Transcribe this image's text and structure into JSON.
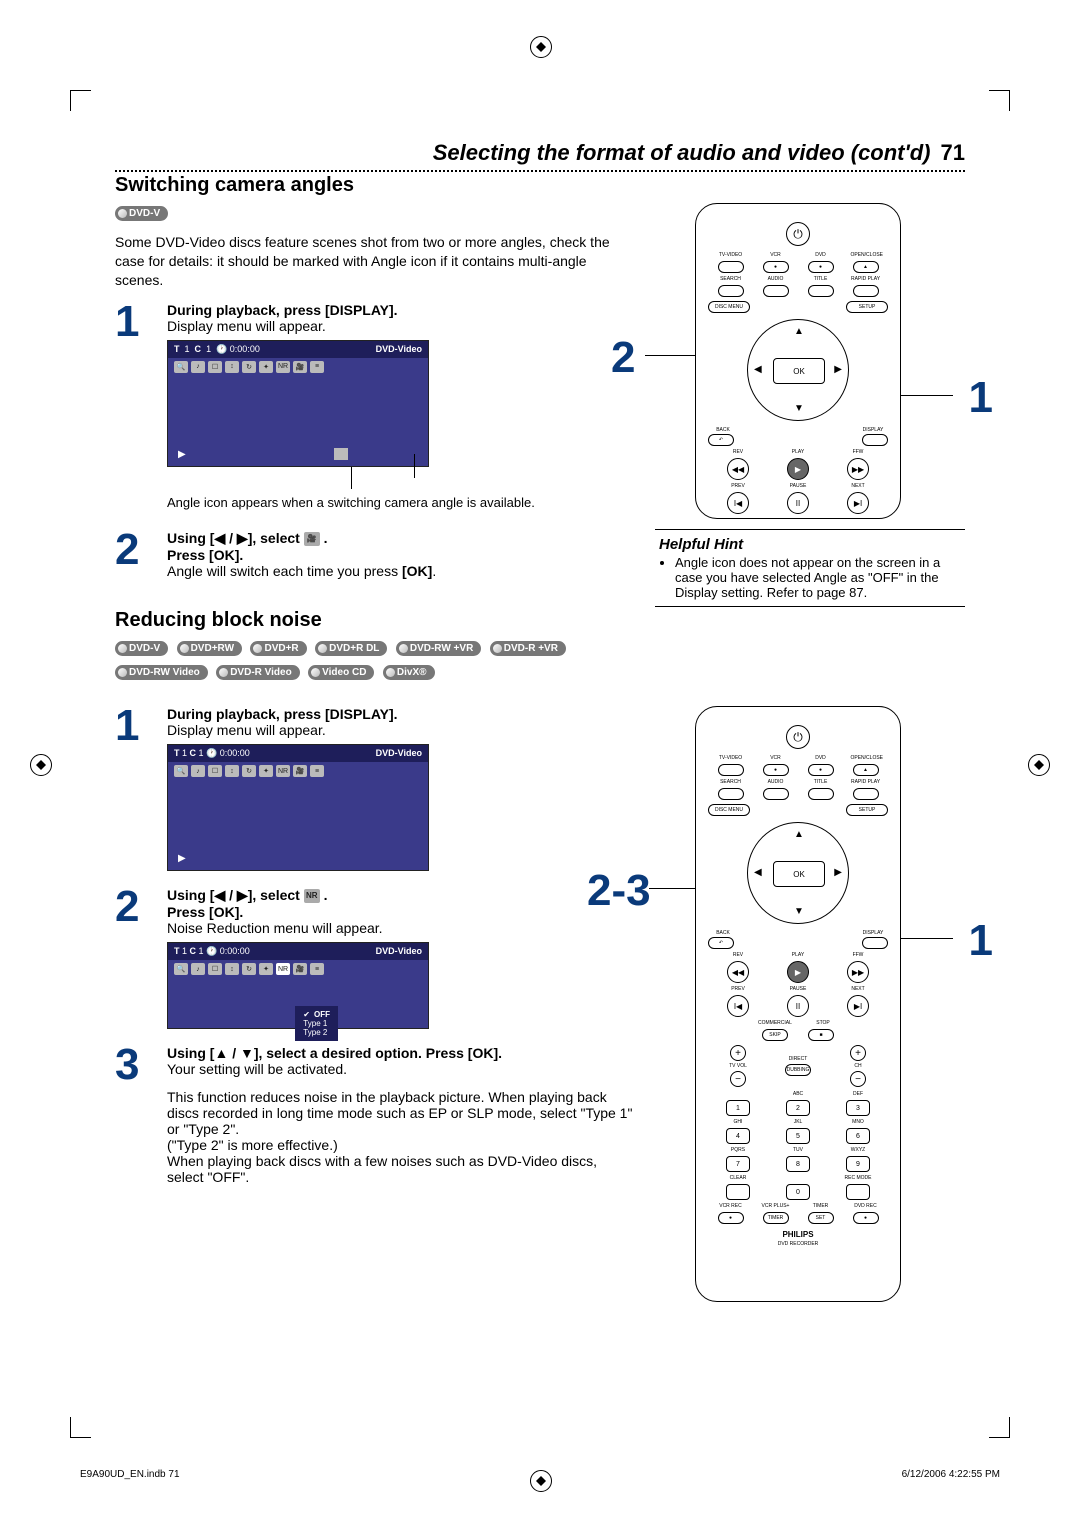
{
  "header": {
    "title": "Selecting the format of audio and video (cont'd)",
    "page": "71"
  },
  "section1": {
    "title": "Switching camera angles",
    "badge": "DVD-V",
    "intro": "Some DVD-Video discs feature scenes shot from two or more angles, check the case for details: it should be marked with Angle icon if it contains multi-angle scenes.",
    "step1_num": "1",
    "step1_bold": "During playback, press [DISPLAY].",
    "step1_text": "Display menu will appear.",
    "display": {
      "t": "T",
      "t_val": "1",
      "c": "C",
      "c_val": "1",
      "time": "0:00:00",
      "type": "DVD-Video"
    },
    "caption1": "Angle icon appears when a switching camera angle is available.",
    "step2_num": "2",
    "step2_line1a": "Using [",
    "step2_line1b": " / ",
    "step2_line1c": "], select ",
    "step2_line1d": " .",
    "step2_line2": "Press [OK].",
    "step2_text": "Angle will switch each time you press [OK]."
  },
  "remote1": {
    "callout_left": "2",
    "callout_right": "1",
    "power": "⏻",
    "row1_labels": [
      "TV-VIDEO",
      "VCR",
      "DVD",
      "OPEN/CLOSE"
    ],
    "row1_btns": [
      "",
      "●",
      "●",
      "▲"
    ],
    "row2_labels": [
      "SEARCH",
      "AUDIO",
      "TITLE",
      "RAPID PLAY"
    ],
    "wide_left": "DISC MENU",
    "wide_right": "SETUP",
    "ok": "OK",
    "row3_labels_l": "BACK",
    "row3_labels_r": "DISPLAY",
    "row4_labels": [
      "REV",
      "PLAY",
      "FFW"
    ],
    "row4_btns": [
      "◀◀",
      "▶",
      "▶▶"
    ],
    "row5_labels": [
      "PREV",
      "PAUSE",
      "NEXT"
    ],
    "row5_btns": [
      "I◀",
      "II",
      "▶I"
    ]
  },
  "hint": {
    "title": "Helpful Hint",
    "item": "Angle icon does not appear on the screen in a case you have selected Angle as \"OFF\" in the Display setting. Refer to page 87."
  },
  "section2": {
    "title": "Reducing block noise",
    "badges": [
      "DVD-V",
      "DVD+RW",
      "DVD+R",
      "DVD+R DL",
      "DVD-RW +VR",
      "DVD-R +VR",
      "DVD-RW Video",
      "DVD-R Video",
      "Video CD",
      "DivX®"
    ],
    "step1_num": "1",
    "step1_bold": "During playback, press [DISPLAY].",
    "step1_text": "Display menu will appear.",
    "step2_num": "2",
    "step2_line1a": "Using [",
    "step2_line1b": " / ",
    "step2_line1c": "], select ",
    "step2_nr": "NR",
    "step2_line1d": " .",
    "step2_line2": "Press [OK].",
    "step2_text": "Noise Reduction menu will appear.",
    "nr_options": [
      "OFF",
      "Type 1",
      "Type 2"
    ],
    "step3_num": "3",
    "step3_bold": "Using [▲ / ▼], select a desired option. Press [OK].",
    "step3_text1": "Your setting will be activated.",
    "step3_text2": "This function reduces noise in the playback picture. When playing back discs recorded in long time mode such as EP or SLP mode, select \"Type 1\" or \"Type 2\".",
    "step3_text3": "(\"Type 2\" is more effective.)",
    "step3_text4": "When playing back discs with a few noises such as DVD-Video discs, select \"OFF\"."
  },
  "remote2": {
    "callout_left": "2-3",
    "callout_right": "1",
    "commercial": "COMMERCIAL",
    "skip": "SKIP",
    "stop": "STOP",
    "stop_btn": "■",
    "tv_vol": "TV VOL",
    "ch": "CH",
    "direct": "DIRECT",
    "dubbing": "DUBBING",
    "num_labels": [
      "",
      "ABC",
      "DEF",
      "GHI",
      "JKL",
      "MNO",
      "PQRS",
      "TUV",
      "WXYZ"
    ],
    "nums": [
      "1",
      "2",
      "3",
      "4",
      "5",
      "6",
      "7",
      "8",
      "9"
    ],
    "clear": "CLEAR",
    "zero": "0",
    "recmode": "REC MODE",
    "bottom_labels": [
      "VCR REC",
      "VCR PLUS+",
      "TIMER",
      "DVD REC"
    ],
    "bottom_btns": [
      "●",
      "TIMER",
      "SET",
      "●"
    ],
    "brand": "PHILIPS",
    "model": "DVD RECORDER"
  },
  "footer": {
    "left": "E9A90UD_EN.indb   71",
    "right": "6/12/2006   4:22:55 PM"
  }
}
